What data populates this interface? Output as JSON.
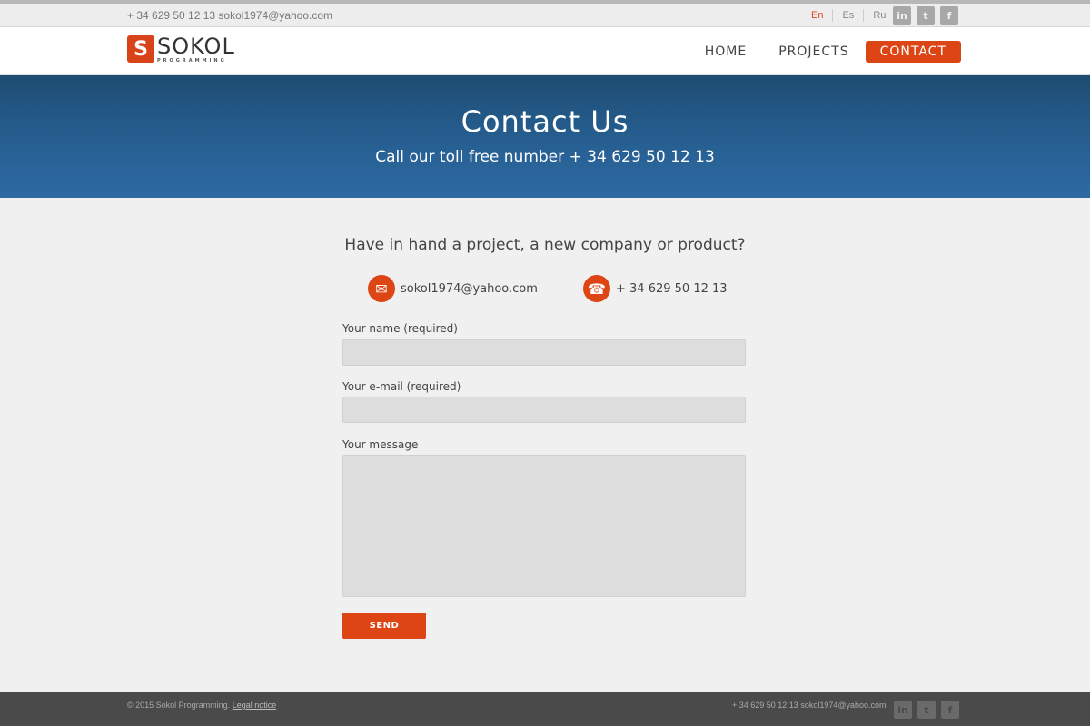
{
  "topbar": {
    "contact": "+ 34 629 50 12 13 sokol1974@yahoo.com",
    "languages": [
      "En",
      "Es",
      "Ru"
    ],
    "active_language": "En",
    "social": [
      "in",
      "t",
      "f"
    ]
  },
  "header": {
    "logo_letter": "S",
    "logo_name": "SOKOL",
    "logo_sub": "PROGRAMMING",
    "nav": [
      "HOME",
      "PROJECTS",
      "CONTACT"
    ],
    "active_nav": "CONTACT"
  },
  "hero": {
    "title": "Contact Us",
    "subtitle": "Call our toll free number + 34 629 50 12 13"
  },
  "main": {
    "tagline": "Have in hand a project, a new company or product?",
    "email": "sokol1974@yahoo.com",
    "phone": "+ 34 629 50 12 13",
    "email_icon": "✉",
    "phone_icon": "☎"
  },
  "form": {
    "name_label": "Your name (required)",
    "name_value": "",
    "email_label": "Your e-mail (required)",
    "email_value": "",
    "message_label": "Your message",
    "message_value": "",
    "send_label": "SEND"
  },
  "footer": {
    "copyright": "© 2015 Sokol Programming.",
    "legal": "Legal notice",
    "contact": "+ 34 629 50 12 13 sokol1974@yahoo.com",
    "social": [
      "in",
      "t",
      "f"
    ]
  },
  "colors": {
    "accent": "#dd4515",
    "hero_top": "#1e4c72",
    "hero_bottom": "#2d6aa3",
    "footer": "#4a4a4a"
  }
}
